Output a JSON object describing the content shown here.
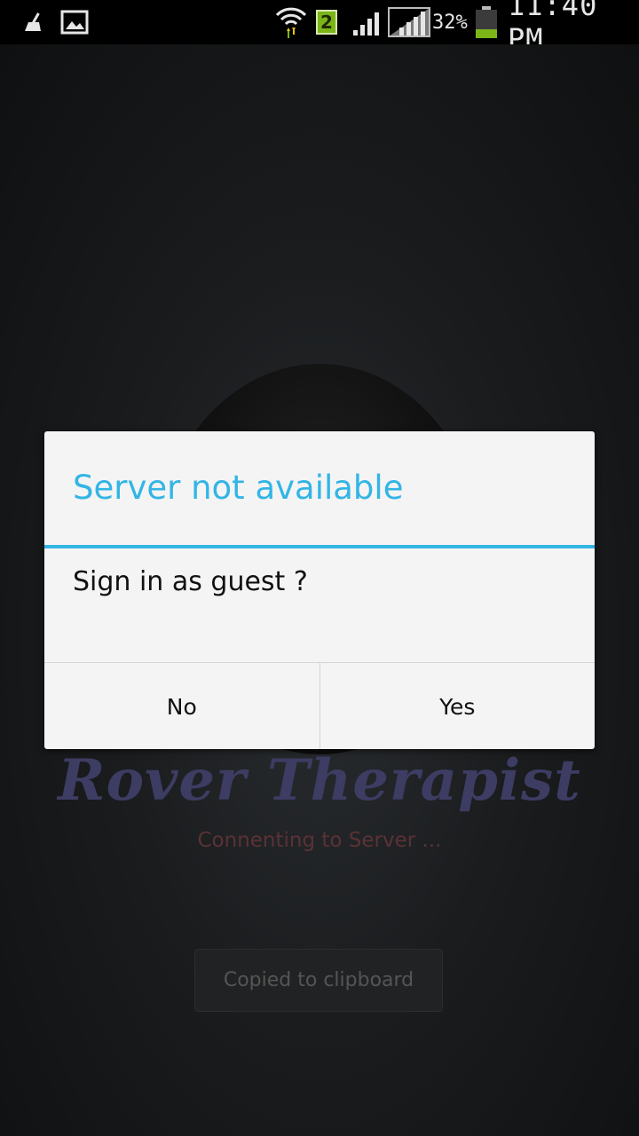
{
  "status_bar": {
    "battery_percent": "32%",
    "time": "11:40 PM",
    "sim_badge": "2",
    "icons": [
      "cleaner-icon",
      "gallery-icon",
      "wifi-icon",
      "sim-2-icon",
      "signal-icon",
      "signal-icon",
      "battery-icon"
    ]
  },
  "app": {
    "title": "Rover Therapist",
    "status_text": "Connenting to Server ...",
    "toast": "Copied to clipboard"
  },
  "dialog": {
    "title": "Server not available",
    "message": "Sign in as guest ?",
    "negative_label": "No",
    "positive_label": "Yes"
  },
  "colors": {
    "accent": "#33b5e5",
    "title": "#3d3c63",
    "status": "#5a3236",
    "battery_fill": "#7cb518"
  }
}
